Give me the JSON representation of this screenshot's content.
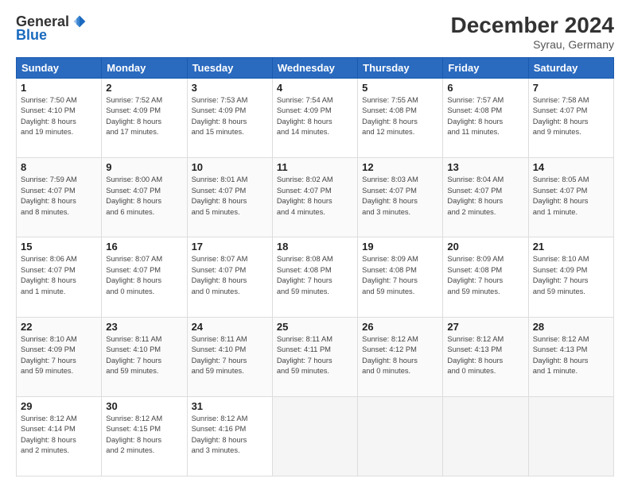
{
  "logo": {
    "general": "General",
    "blue": "Blue"
  },
  "title": "December 2024",
  "location": "Syrau, Germany",
  "days_of_week": [
    "Sunday",
    "Monday",
    "Tuesday",
    "Wednesday",
    "Thursday",
    "Friday",
    "Saturday"
  ],
  "weeks": [
    [
      {
        "day": 1,
        "info": "Sunrise: 7:50 AM\nSunset: 4:10 PM\nDaylight: 8 hours\nand 19 minutes."
      },
      {
        "day": 2,
        "info": "Sunrise: 7:52 AM\nSunset: 4:09 PM\nDaylight: 8 hours\nand 17 minutes."
      },
      {
        "day": 3,
        "info": "Sunrise: 7:53 AM\nSunset: 4:09 PM\nDaylight: 8 hours\nand 15 minutes."
      },
      {
        "day": 4,
        "info": "Sunrise: 7:54 AM\nSunset: 4:09 PM\nDaylight: 8 hours\nand 14 minutes."
      },
      {
        "day": 5,
        "info": "Sunrise: 7:55 AM\nSunset: 4:08 PM\nDaylight: 8 hours\nand 12 minutes."
      },
      {
        "day": 6,
        "info": "Sunrise: 7:57 AM\nSunset: 4:08 PM\nDaylight: 8 hours\nand 11 minutes."
      },
      {
        "day": 7,
        "info": "Sunrise: 7:58 AM\nSunset: 4:07 PM\nDaylight: 8 hours\nand 9 minutes."
      }
    ],
    [
      {
        "day": 8,
        "info": "Sunrise: 7:59 AM\nSunset: 4:07 PM\nDaylight: 8 hours\nand 8 minutes."
      },
      {
        "day": 9,
        "info": "Sunrise: 8:00 AM\nSunset: 4:07 PM\nDaylight: 8 hours\nand 6 minutes."
      },
      {
        "day": 10,
        "info": "Sunrise: 8:01 AM\nSunset: 4:07 PM\nDaylight: 8 hours\nand 5 minutes."
      },
      {
        "day": 11,
        "info": "Sunrise: 8:02 AM\nSunset: 4:07 PM\nDaylight: 8 hours\nand 4 minutes."
      },
      {
        "day": 12,
        "info": "Sunrise: 8:03 AM\nSunset: 4:07 PM\nDaylight: 8 hours\nand 3 minutes."
      },
      {
        "day": 13,
        "info": "Sunrise: 8:04 AM\nSunset: 4:07 PM\nDaylight: 8 hours\nand 2 minutes."
      },
      {
        "day": 14,
        "info": "Sunrise: 8:05 AM\nSunset: 4:07 PM\nDaylight: 8 hours\nand 1 minute."
      }
    ],
    [
      {
        "day": 15,
        "info": "Sunrise: 8:06 AM\nSunset: 4:07 PM\nDaylight: 8 hours\nand 1 minute."
      },
      {
        "day": 16,
        "info": "Sunrise: 8:07 AM\nSunset: 4:07 PM\nDaylight: 8 hours\nand 0 minutes."
      },
      {
        "day": 17,
        "info": "Sunrise: 8:07 AM\nSunset: 4:07 PM\nDaylight: 8 hours\nand 0 minutes."
      },
      {
        "day": 18,
        "info": "Sunrise: 8:08 AM\nSunset: 4:08 PM\nDaylight: 7 hours\nand 59 minutes."
      },
      {
        "day": 19,
        "info": "Sunrise: 8:09 AM\nSunset: 4:08 PM\nDaylight: 7 hours\nand 59 minutes."
      },
      {
        "day": 20,
        "info": "Sunrise: 8:09 AM\nSunset: 4:08 PM\nDaylight: 7 hours\nand 59 minutes."
      },
      {
        "day": 21,
        "info": "Sunrise: 8:10 AM\nSunset: 4:09 PM\nDaylight: 7 hours\nand 59 minutes."
      }
    ],
    [
      {
        "day": 22,
        "info": "Sunrise: 8:10 AM\nSunset: 4:09 PM\nDaylight: 7 hours\nand 59 minutes."
      },
      {
        "day": 23,
        "info": "Sunrise: 8:11 AM\nSunset: 4:10 PM\nDaylight: 7 hours\nand 59 minutes."
      },
      {
        "day": 24,
        "info": "Sunrise: 8:11 AM\nSunset: 4:10 PM\nDaylight: 7 hours\nand 59 minutes."
      },
      {
        "day": 25,
        "info": "Sunrise: 8:11 AM\nSunset: 4:11 PM\nDaylight: 7 hours\nand 59 minutes."
      },
      {
        "day": 26,
        "info": "Sunrise: 8:12 AM\nSunset: 4:12 PM\nDaylight: 8 hours\nand 0 minutes."
      },
      {
        "day": 27,
        "info": "Sunrise: 8:12 AM\nSunset: 4:13 PM\nDaylight: 8 hours\nand 0 minutes."
      },
      {
        "day": 28,
        "info": "Sunrise: 8:12 AM\nSunset: 4:13 PM\nDaylight: 8 hours\nand 1 minute."
      }
    ],
    [
      {
        "day": 29,
        "info": "Sunrise: 8:12 AM\nSunset: 4:14 PM\nDaylight: 8 hours\nand 2 minutes."
      },
      {
        "day": 30,
        "info": "Sunrise: 8:12 AM\nSunset: 4:15 PM\nDaylight: 8 hours\nand 2 minutes."
      },
      {
        "day": 31,
        "info": "Sunrise: 8:12 AM\nSunset: 4:16 PM\nDaylight: 8 hours\nand 3 minutes."
      },
      null,
      null,
      null,
      null
    ]
  ]
}
